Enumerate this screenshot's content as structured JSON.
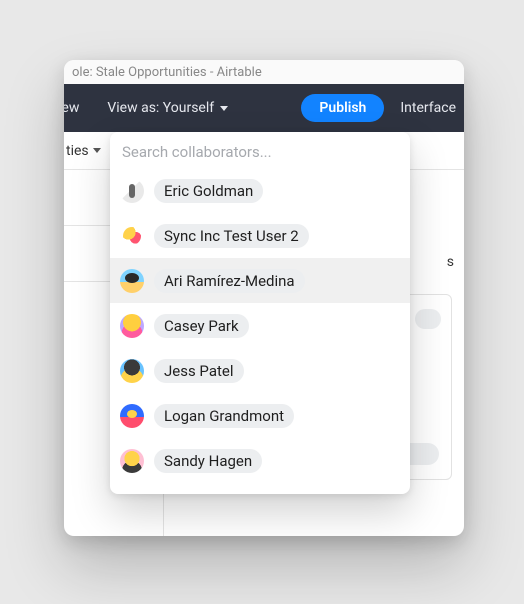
{
  "window": {
    "title_fragment": "ole: Stale Opportunities - Airtable"
  },
  "topbar": {
    "left_fragment": "iew",
    "view_as_label": "View as: Yourself",
    "publish_label": "Publish",
    "right_fragment": "Interface"
  },
  "subbar": {
    "truncated_label": "ties"
  },
  "card_stub_char": "s",
  "dropdown": {
    "search_placeholder": "Search collaborators...",
    "hover_index": 2,
    "items": [
      {
        "name": "Eric Goldman",
        "avatar": "av-a"
      },
      {
        "name": "Sync Inc Test User 2",
        "avatar": "av-b"
      },
      {
        "name": "Ari Ramírez-Medina",
        "avatar": "av-c"
      },
      {
        "name": "Casey Park",
        "avatar": "av-d"
      },
      {
        "name": "Jess Patel",
        "avatar": "av-e"
      },
      {
        "name": "Logan Grandmont",
        "avatar": "av-f"
      },
      {
        "name": "Sandy Hagen",
        "avatar": "av-g"
      }
    ]
  }
}
